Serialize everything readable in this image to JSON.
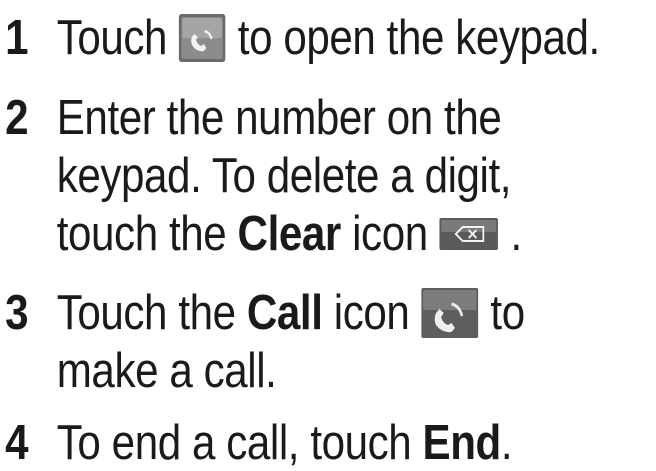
{
  "steps": [
    {
      "number": "1",
      "lines": [
        {
          "before": "Touch",
          "icon": "phone-button-icon",
          "after": "to open the keypad."
        }
      ]
    },
    {
      "number": "2",
      "lines": [
        {
          "text": "Enter the number on the"
        },
        {
          "text": "keypad. To delete a digit,"
        },
        {
          "before": "touch the",
          "bold": "Clear",
          "middle": "icon",
          "icon": "backspace-clear-icon",
          "after": "."
        }
      ]
    },
    {
      "number": "3",
      "lines": [
        {
          "before": "Touch the",
          "bold": "Call",
          "middle": "icon",
          "icon": "call-handset-icon",
          "after": "to"
        },
        {
          "text": "make a call."
        }
      ]
    },
    {
      "number": "4",
      "lines": [
        {
          "before": "To end a call, touch",
          "bold": "End",
          "after": "."
        }
      ]
    }
  ],
  "colors": {
    "text": "#1a1a1a",
    "icon_dark": "#4a4a4a",
    "icon_light": "#cfcfcf"
  }
}
